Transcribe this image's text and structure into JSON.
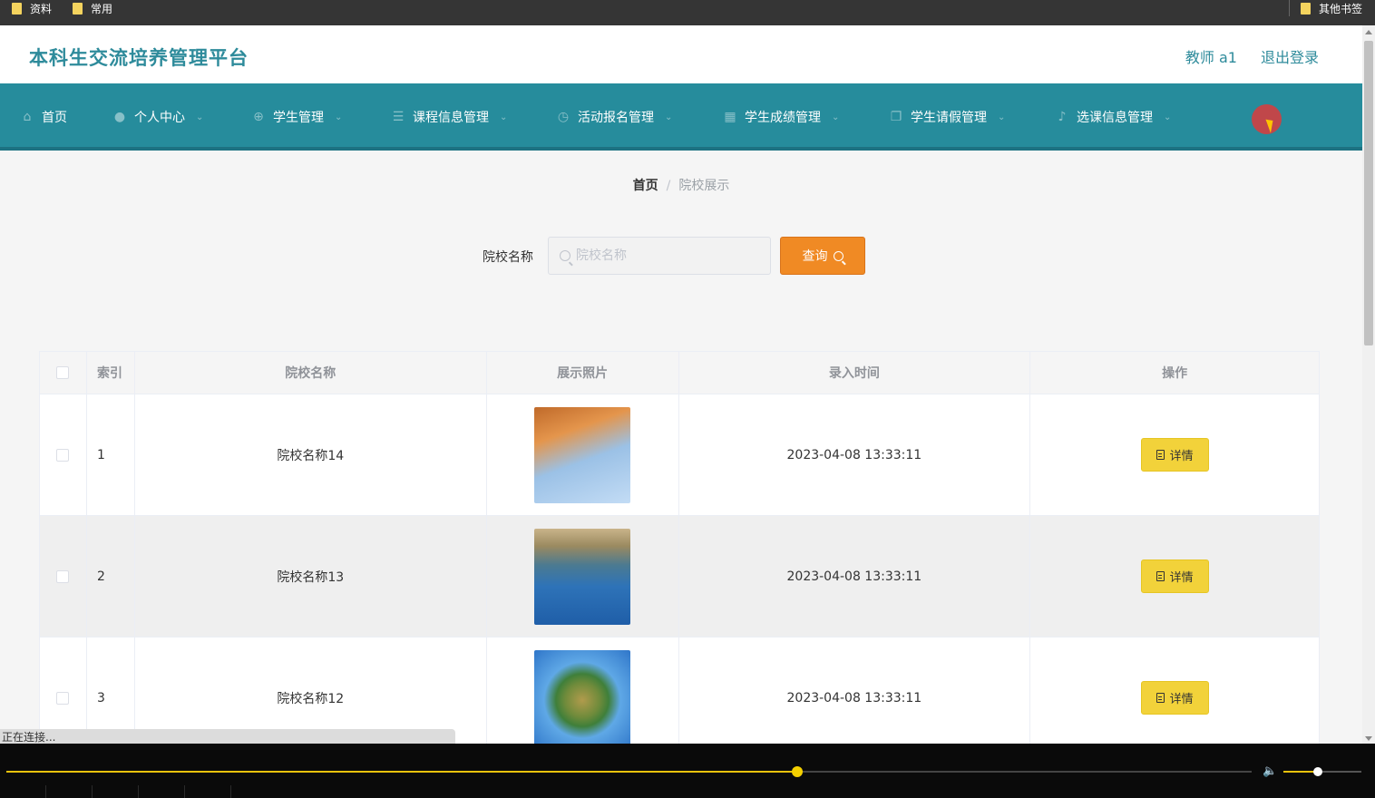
{
  "bookmarks": {
    "left": [
      "资料",
      "常用"
    ],
    "right": "其他书签"
  },
  "header": {
    "title": "本科生交流培养管理平台",
    "user_label": "教师 a1",
    "logout_label": "退出登录"
  },
  "nav": {
    "items": [
      {
        "label": "首页",
        "icon": "home-icon",
        "has_caret": false
      },
      {
        "label": "个人中心",
        "icon": "user-icon",
        "has_caret": true
      },
      {
        "label": "学生管理",
        "icon": "grid-circle-icon",
        "has_caret": true
      },
      {
        "label": "课程信息管理",
        "icon": "list-icon",
        "has_caret": true
      },
      {
        "label": "活动报名管理",
        "icon": "clock-icon",
        "has_caret": true
      },
      {
        "label": "学生成绩管理",
        "icon": "grid-icon",
        "has_caret": true
      },
      {
        "label": "学生请假管理",
        "icon": "copy-icon",
        "has_caret": true
      },
      {
        "label": "选课信息管理",
        "icon": "mic-icon",
        "has_caret": true
      }
    ]
  },
  "breadcrumb": {
    "home": "首页",
    "separator": "/",
    "current": "院校展示"
  },
  "search": {
    "label": "院校名称",
    "placeholder": "院校名称",
    "value": "",
    "button_label": "查询"
  },
  "table": {
    "columns": [
      "索引",
      "院校名称",
      "展示照片",
      "录入时间",
      "操作"
    ],
    "rows": [
      {
        "index": "1",
        "name": "院校名称14",
        "photo": "autumn-leaves-photo",
        "time": "2023-04-08 13:33:11",
        "action": "详情"
      },
      {
        "index": "2",
        "name": "院校名称13",
        "photo": "coastline-photo",
        "time": "2023-04-08 13:33:11",
        "action": "详情"
      },
      {
        "index": "3",
        "name": "院校名称12",
        "photo": "tiny-planet-photo",
        "time": "2023-04-08 13:33:11",
        "action": "详情"
      }
    ]
  },
  "status_bar": {
    "text": "正在连接..."
  },
  "player": {
    "progress": 0.635,
    "volume": 0.44
  },
  "colors": {
    "brand_teal": "#268c9c",
    "title_teal": "#2e8b9b",
    "query_orange": "#f08a24",
    "detail_yellow": "#f2d23a",
    "progress_yellow": "#e8c20c"
  }
}
